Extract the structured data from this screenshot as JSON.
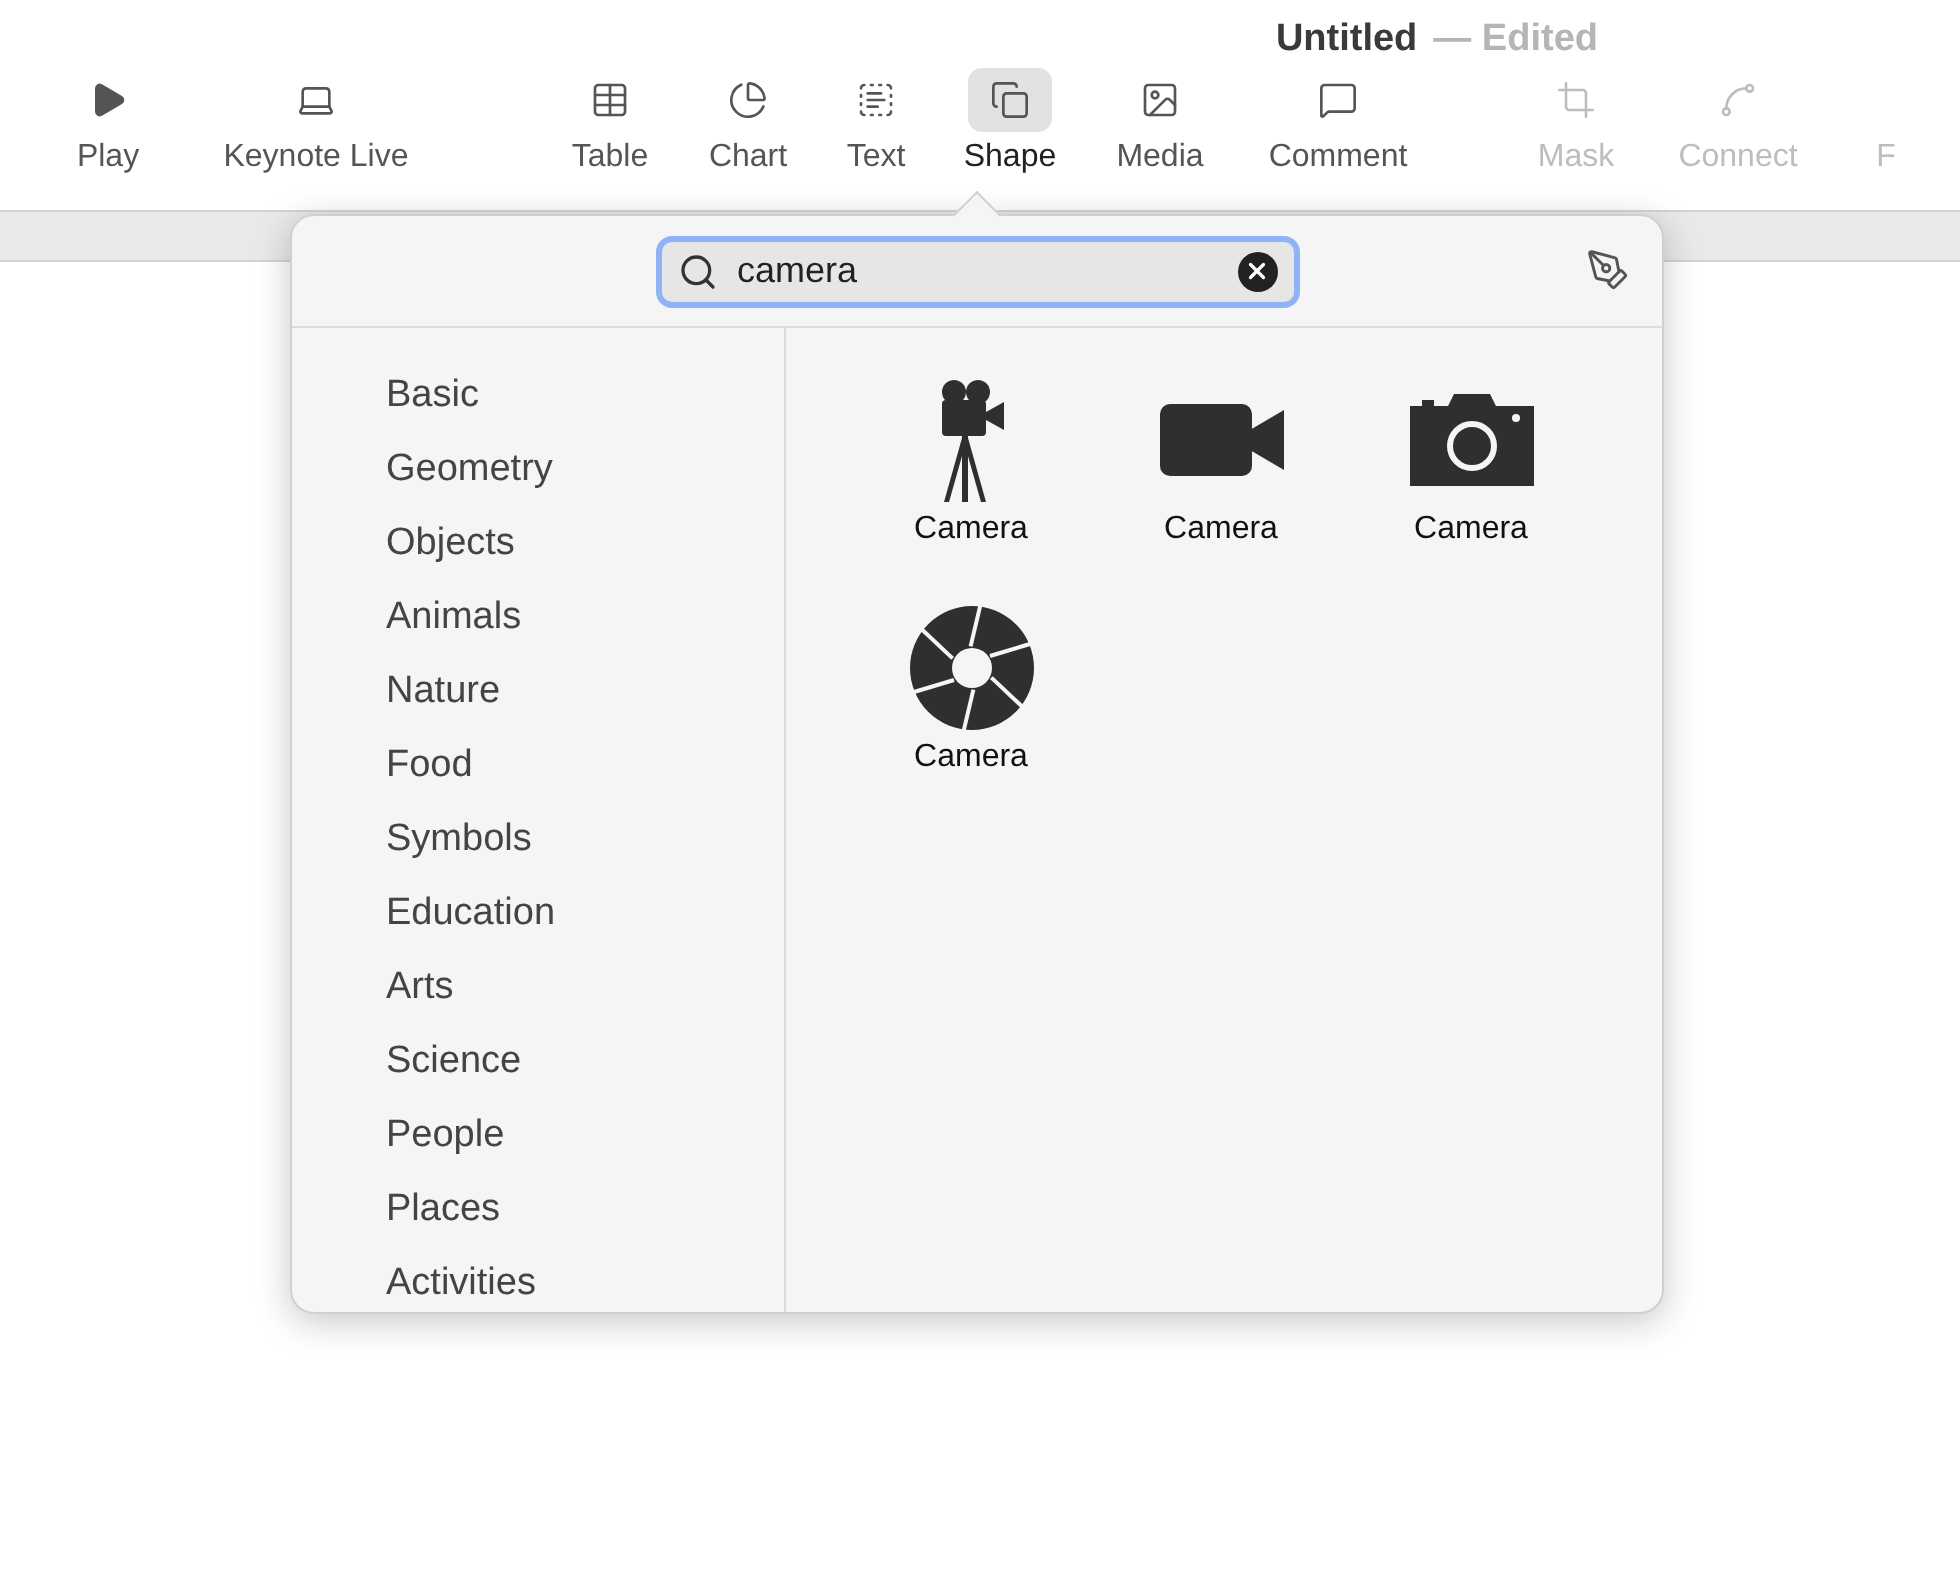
{
  "window": {
    "title": "Untitled",
    "status": "— Edited"
  },
  "toolbar": [
    {
      "label": "Play",
      "selected": false,
      "disabled": false
    },
    {
      "label": "Keynote Live",
      "selected": false,
      "disabled": false
    },
    {
      "label": "Table",
      "selected": false,
      "disabled": false
    },
    {
      "label": "Chart",
      "selected": false,
      "disabled": false
    },
    {
      "label": "Text",
      "selected": false,
      "disabled": false
    },
    {
      "label": "Shape",
      "selected": true,
      "disabled": false
    },
    {
      "label": "Media",
      "selected": false,
      "disabled": false
    },
    {
      "label": "Comment",
      "selected": false,
      "disabled": false
    },
    {
      "label": "Mask",
      "selected": false,
      "disabled": true
    },
    {
      "label": "Connect",
      "selected": false,
      "disabled": true
    },
    {
      "label": "F",
      "selected": false,
      "disabled": true
    }
  ],
  "shape_popover": {
    "search": {
      "value": "camera"
    },
    "categories": [
      "Basic",
      "Geometry",
      "Objects",
      "Animals",
      "Nature",
      "Food",
      "Symbols",
      "Education",
      "Arts",
      "Science",
      "People",
      "Places",
      "Activities"
    ],
    "results": [
      {
        "label": "Camera"
      },
      {
        "label": "Camera"
      },
      {
        "label": "Camera"
      },
      {
        "label": "Camera"
      }
    ]
  }
}
